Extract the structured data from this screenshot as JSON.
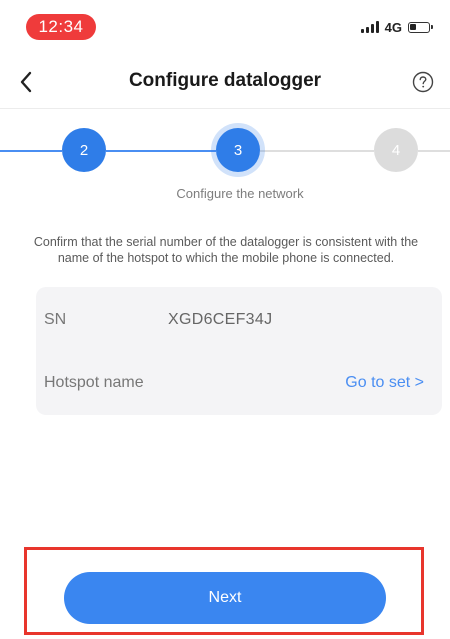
{
  "status_bar": {
    "time": "12:34",
    "network_type": "4G"
  },
  "header": {
    "title": "Configure datalogger"
  },
  "stepper": {
    "steps": [
      {
        "label": "2",
        "state": "done"
      },
      {
        "label": "3",
        "state": "current"
      },
      {
        "label": "4",
        "state": "todo"
      }
    ],
    "current_caption": "Configure the network"
  },
  "instruction": "Confirm that the serial number of the datalogger is consistent with the name of the hotspot to which the mobile phone is connected.",
  "info": {
    "sn_label": "SN",
    "sn_value": "XGD6CEF34J",
    "hotspot_label": "Hotspot name",
    "go_to_set": "Go to set >"
  },
  "actions": {
    "next_label": "Next"
  },
  "colors": {
    "accent": "#3a86f0",
    "step_active": "#2f7de8",
    "step_inactive": "#dcdcdc",
    "time_pill": "#ef3b3b",
    "highlight_frame": "#e8352c"
  },
  "icons": {
    "back": "chevron-left-icon",
    "help": "question-circle-icon",
    "signal": "signal-bars-icon",
    "battery": "battery-icon"
  }
}
